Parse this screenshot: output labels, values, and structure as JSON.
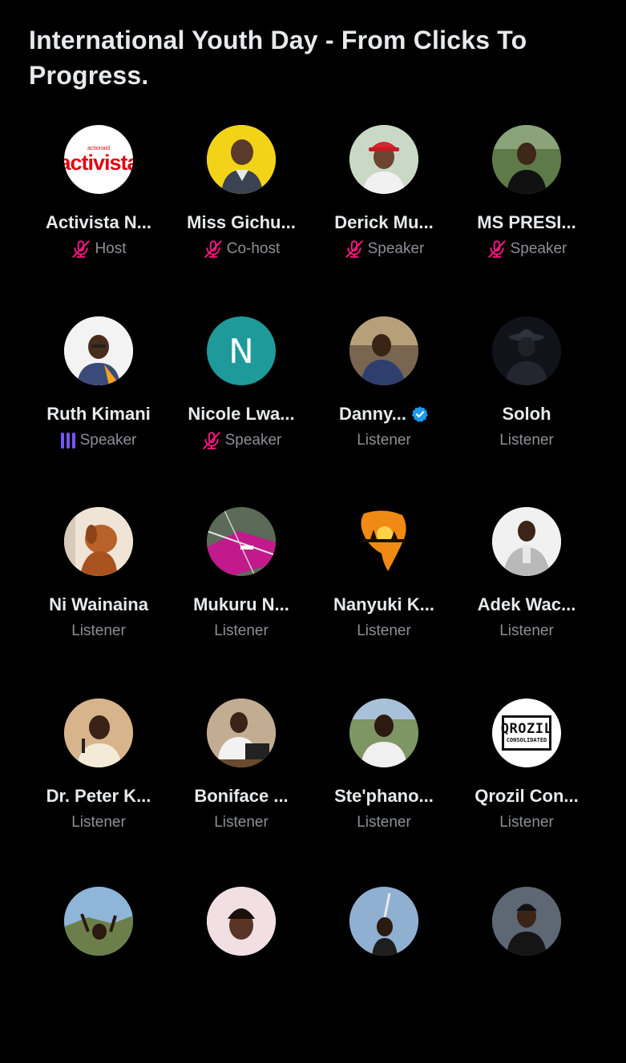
{
  "space": {
    "title": "International Youth Day - From Clicks To Progress."
  },
  "participants": [
    {
      "name": "Activista N...",
      "role": "Host",
      "status": "muted",
      "avatar": "activista-logo",
      "avatar_text": "activista"
    },
    {
      "name": "Miss Gichu...",
      "role": "Co-host",
      "status": "muted",
      "avatar": "woman-yellow-bg"
    },
    {
      "name": "Derick Mu...",
      "role": "Speaker",
      "status": "muted",
      "avatar": "man-red-cap"
    },
    {
      "name": "MS PRESI...",
      "role": "Speaker",
      "status": "muted",
      "avatar": "woman-outdoors"
    },
    {
      "name": "Ruth Kimani",
      "role": "Speaker",
      "status": "speaking",
      "avatar": "woman-glasses"
    },
    {
      "name": "Nicole Lwa...",
      "role": "Speaker",
      "status": "muted",
      "avatar": "initial-n",
      "avatar_text": "N"
    },
    {
      "name": "Danny...",
      "role": "Listener",
      "status": "verified",
      "avatar": "man-sitting"
    },
    {
      "name": "Soloh",
      "role": "Listener",
      "status": "none",
      "avatar": "man-hat-dark"
    },
    {
      "name": "Ni Wainaina",
      "role": "Listener",
      "status": "none",
      "avatar": "dog-photo"
    },
    {
      "name": "Mukuru N...",
      "role": "Listener",
      "status": "none",
      "avatar": "map-photo"
    },
    {
      "name": "Nanyuki K...",
      "role": "Listener",
      "status": "none",
      "avatar": "africa-sunset"
    },
    {
      "name": "Adek Wac...",
      "role": "Listener",
      "status": "none",
      "avatar": "man-suit-light"
    },
    {
      "name": "Dr. Peter K...",
      "role": "Listener",
      "status": "none",
      "avatar": "woman-microphone"
    },
    {
      "name": "Boniface ...",
      "role": "Listener",
      "status": "none",
      "avatar": "man-laptop"
    },
    {
      "name": "Ste'phano...",
      "role": "Listener",
      "status": "none",
      "avatar": "man-outdoors"
    },
    {
      "name": "Qrozil Con...",
      "role": "Listener",
      "status": "none",
      "avatar": "qrozil-logo",
      "avatar_text": "QROZIL",
      "avatar_subtext": "CONSOLIDATED"
    },
    {
      "name": "",
      "role": "",
      "status": "none",
      "avatar": "man-hills"
    },
    {
      "name": "",
      "role": "",
      "status": "none",
      "avatar": "woman-selfie"
    },
    {
      "name": "",
      "role": "",
      "status": "none",
      "avatar": "man-sign"
    },
    {
      "name": "",
      "role": "",
      "status": "none",
      "avatar": "woman-portrait"
    }
  ],
  "colors": {
    "background": "#000000",
    "muted_icon": "#f91880",
    "speaking_bars": "#7856ff",
    "verified_badge": "#1d9bf0",
    "role_text": "#8b9096"
  }
}
